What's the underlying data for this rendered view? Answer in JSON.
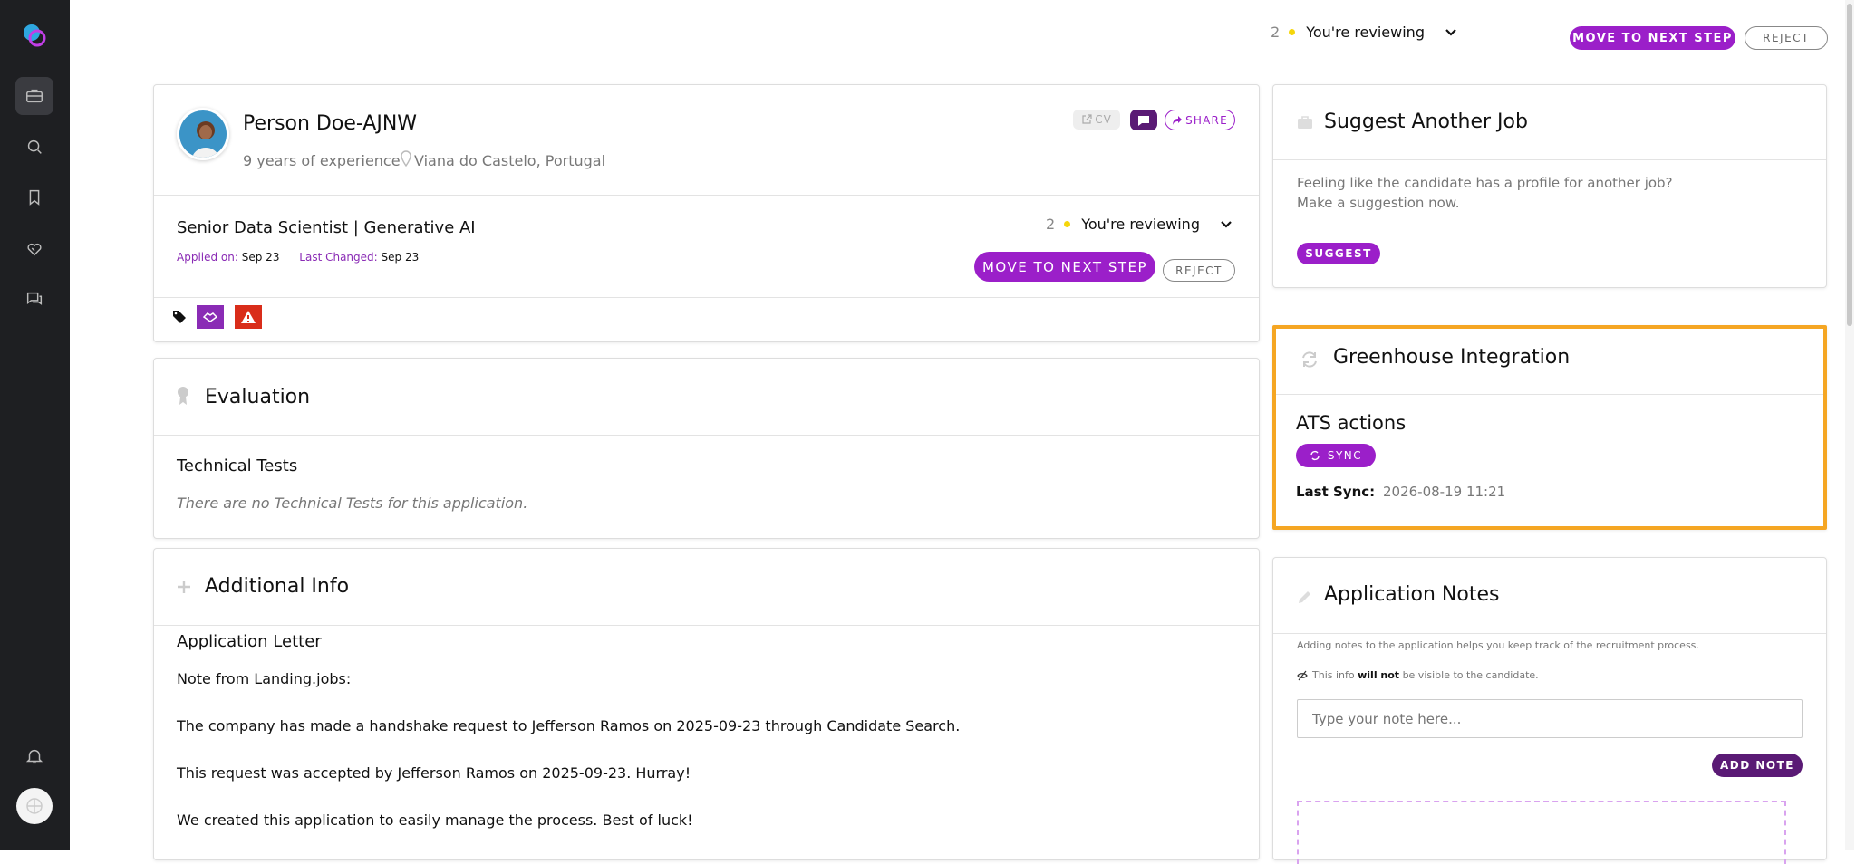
{
  "top": {
    "count": "2",
    "status": "You're reviewing",
    "move_label": "MOVE TO NEXT STEP",
    "reject_label": "REJECT"
  },
  "candidate": {
    "name": "Person Doe-AJNW",
    "experience": "9 years of experience",
    "location": "Viana do Castelo, Portugal",
    "cv_label": "CV",
    "share_label": "SHARE"
  },
  "job": {
    "title": "Senior Data Scientist | Generative AI",
    "applied_label": "Applied on:",
    "applied_value": "Sep 23",
    "changed_label": "Last Changed:",
    "changed_value": "Sep 23",
    "count": "2",
    "status": "You're reviewing",
    "move_label": "MOVE TO NEXT STEP",
    "reject_label": "REJECT"
  },
  "evaluation": {
    "title": "Evaluation",
    "section": "Technical Tests",
    "empty_text": "There are no Technical Tests for this application."
  },
  "additional": {
    "title": "Additional Info",
    "section": "Application Letter",
    "lines": [
      "Note from Landing.jobs:",
      "The company has made a handshake request to Jefferson Ramos on 2025-09-23 through Candidate Search.",
      "This request was accepted by Jefferson Ramos on 2025-09-23. Hurray!",
      "We created this application to easily manage the process. Best of luck!"
    ]
  },
  "suggest": {
    "title": "Suggest Another Job",
    "line1": "Feeling like the candidate has a profile for another job?",
    "line2": "Make a suggestion now.",
    "button": "SUGGEST"
  },
  "greenhouse": {
    "title": "Greenhouse Integration",
    "subtitle": "ATS actions",
    "sync_label": "SYNC",
    "last_sync_label": "Last Sync:",
    "last_sync_value": "2026-08-19 11:21"
  },
  "notes": {
    "title": "Application Notes",
    "help": "Adding notes to the application helps you keep track of the recruitment process.",
    "vis_prefix": "This info",
    "vis_bold": "will not",
    "vis_suffix": "be visible to the candidate.",
    "placeholder": "Type your note here...",
    "button": "ADD NOTE"
  },
  "colors": {
    "accent": "#9b1fc9",
    "highlight": "#f5a623",
    "sidebar": "#1e1f22",
    "status_dot": "#f5d60b"
  }
}
